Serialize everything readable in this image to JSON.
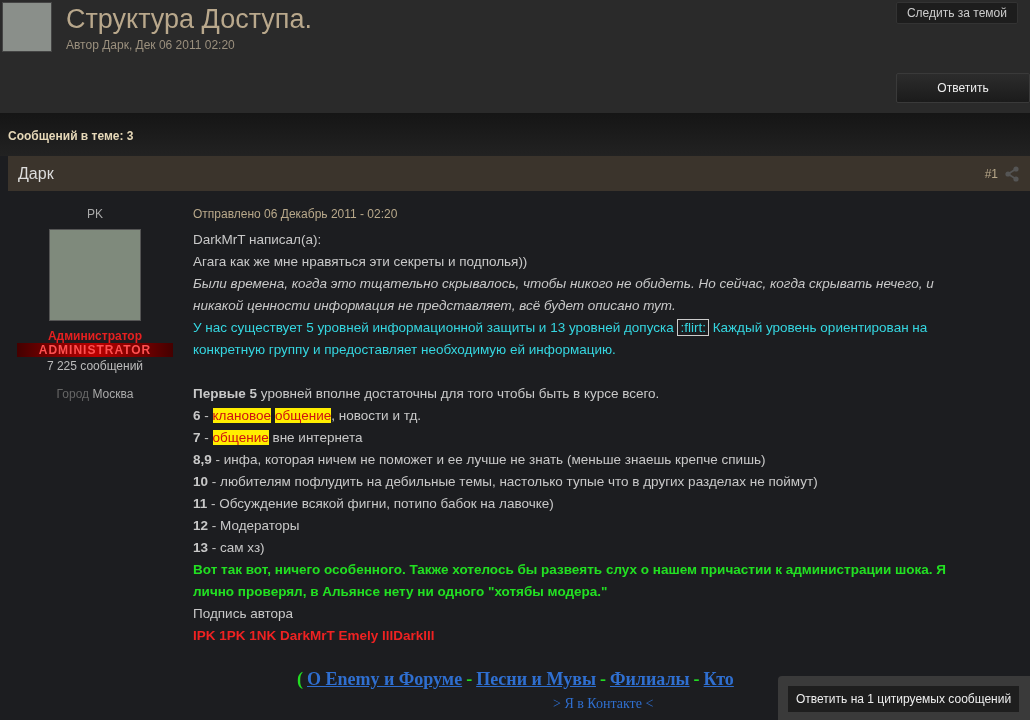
{
  "topic": {
    "title": "Структура Доступа.",
    "byline": "Автор Дарк, Дек 06 2011 02:20",
    "follow_button": "Следить за темой",
    "reply_button": "Ответить"
  },
  "posts_count": "Сообщений в теме: 3",
  "post": {
    "author": "Дарк",
    "number": "#1",
    "user": {
      "name": "PK",
      "group": "Администратор",
      "badge": "ADMINISTRATOR",
      "count": "7 225 сообщений",
      "city_label": "Город",
      "city": "Москва"
    },
    "date": "Отправлено 06 Декабрь 2011 - 02:20",
    "lines": [
      {
        "kind": "plain",
        "segments": [
          {
            "kind": "text",
            "text": "DarkMrT написал(а):"
          }
        ]
      },
      {
        "kind": "plain",
        "segments": [
          {
            "kind": "text",
            "text": "Агага как же мне нравяться эти секреты и подполья))"
          }
        ]
      },
      {
        "kind": "italic",
        "segments": [
          {
            "kind": "text",
            "text": "Были времена, когда это тщательно скрывалось, чтобы никого не обидеть. Но сейчас, когда скрывать нечего, и никакой ценности информация не представляет, всё будет описано тут."
          }
        ]
      },
      {
        "kind": "cyan",
        "segments": [
          {
            "kind": "text",
            "text": "У нас существует 5 уровней информационной защиты и 13 уровней допуска "
          },
          {
            "kind": "emoticon",
            "text": ":flirt:"
          },
          {
            "kind": "text",
            "text": " Каждый уровень ориентирован на конкретную группу и предоставляет необходимую ей информацию."
          }
        ]
      },
      {
        "kind": "blank"
      },
      {
        "kind": "plain",
        "segments": [
          {
            "kind": "bold",
            "text": "Первые 5"
          },
          {
            "kind": "text",
            "text": " уровней вполне достаточны для того чтобы быть в курсе всего."
          }
        ]
      },
      {
        "kind": "plain",
        "segments": [
          {
            "kind": "bold",
            "text": "6"
          },
          {
            "kind": "text",
            "text": " - "
          },
          {
            "kind": "highlight",
            "text": "клановое"
          },
          {
            "kind": "highlight",
            "text": "общение"
          },
          {
            "kind": "text",
            "text": ", новости и тд."
          }
        ]
      },
      {
        "kind": "plain",
        "segments": [
          {
            "kind": "bold",
            "text": "7"
          },
          {
            "kind": "text",
            "text": " - "
          },
          {
            "kind": "highlight",
            "text": "общение"
          },
          {
            "kind": "text",
            "text": " вне интернета"
          }
        ]
      },
      {
        "kind": "plain",
        "segments": [
          {
            "kind": "bold",
            "text": "8,9"
          },
          {
            "kind": "text",
            "text": " - инфа, которая ничем не поможет и ее лучше не знать (меньше знаешь крепче спишь)"
          }
        ]
      },
      {
        "kind": "plain",
        "segments": [
          {
            "kind": "bold",
            "text": "10"
          },
          {
            "kind": "text",
            "text": " - любителям пофлудить на дебильные темы, настолько тупые что в других разделах не поймут)"
          }
        ]
      },
      {
        "kind": "plain",
        "segments": [
          {
            "kind": "bold",
            "text": "11"
          },
          {
            "kind": "text",
            "text": " - Обсуждение всякой фигни, потипо бабок на лавочке)"
          }
        ]
      },
      {
        "kind": "plain",
        "segments": [
          {
            "kind": "bold",
            "text": "12"
          },
          {
            "kind": "text",
            "text": " - Модераторы"
          }
        ]
      },
      {
        "kind": "plain",
        "segments": [
          {
            "kind": "bold",
            "text": "13"
          },
          {
            "kind": "text",
            "text": " - сам хз)"
          }
        ]
      },
      {
        "kind": "green",
        "segments": [
          {
            "kind": "text",
            "text": "Вот так вот, ничего особенного. Также хотелось бы развеять слух о нашем причастии к администрации шока. Я лично проверял, в Альянсе нету ни одного \"хотябы модера.\""
          }
        ]
      }
    ],
    "signature_label": "Подпись автора",
    "signature": "IPK 1PK 1NK DarkMrT Emely lllDarklll",
    "footer_open": "(",
    "footer_links": [
      "О Enemy и Форуме",
      "Песни и Мувы",
      "Филиалы",
      "Кто"
    ],
    "footer_separator": "-",
    "footer_sub": "> Я в Контакте <"
  },
  "quote_popup": {
    "button": "Ответить на 1 цитируемых сообщений"
  }
}
